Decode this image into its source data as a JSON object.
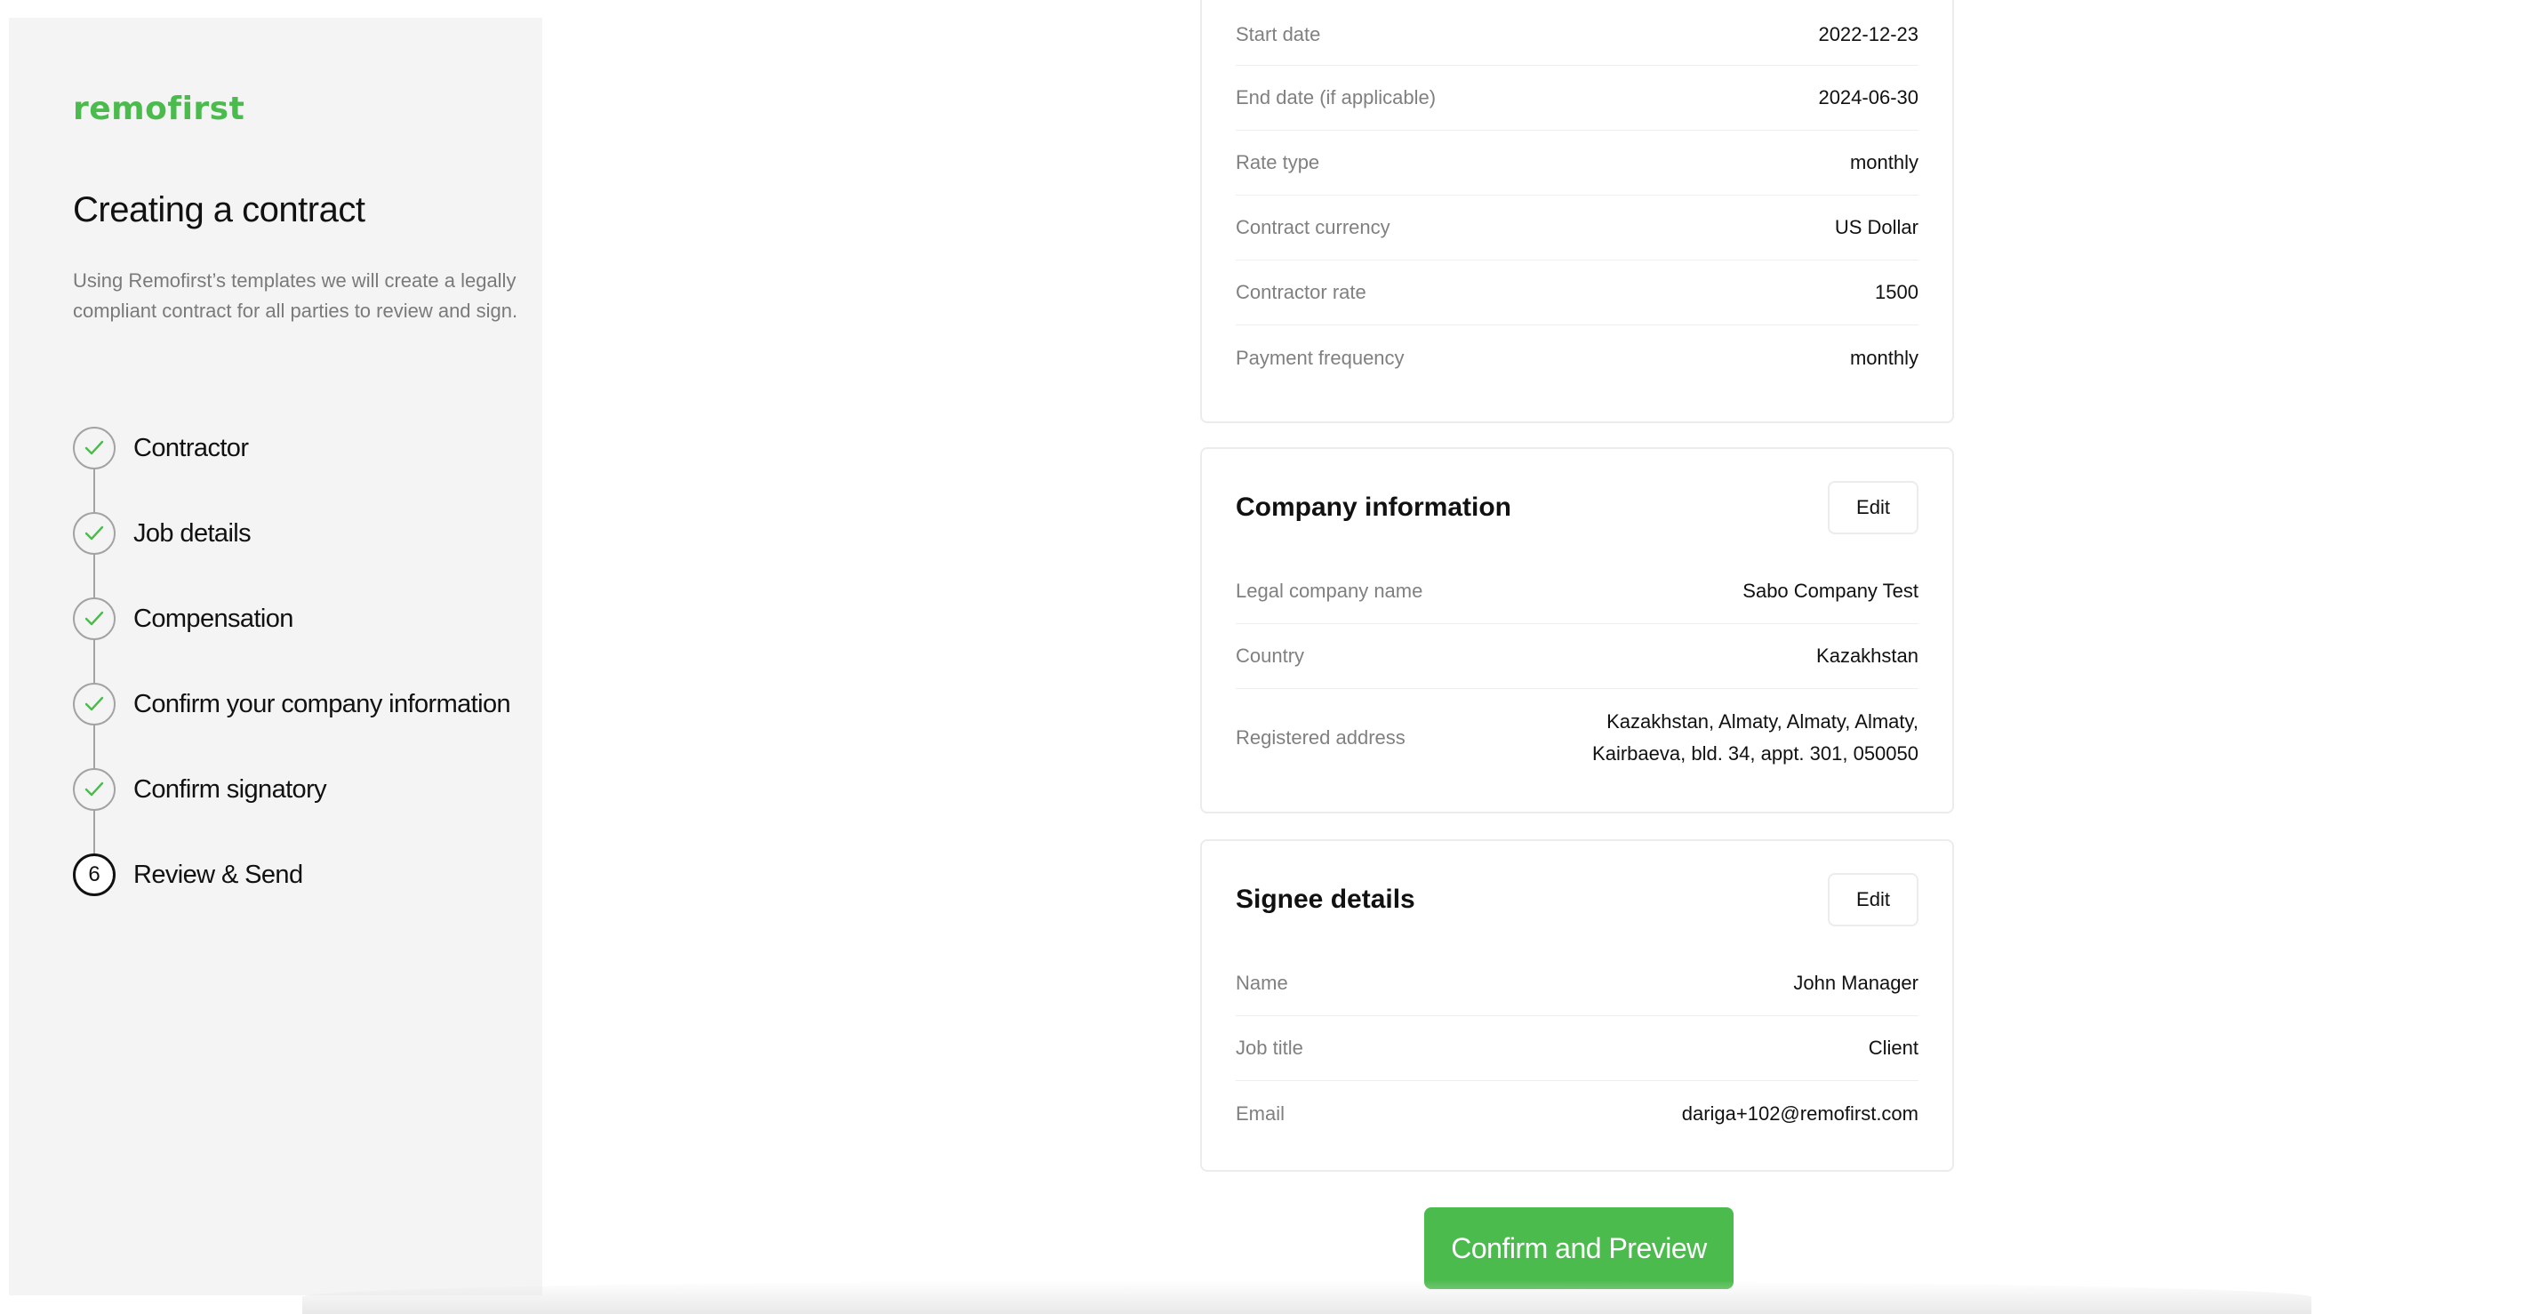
{
  "sidebar": {
    "logo": "remofirst",
    "title": "Creating a contract",
    "description": "Using Remofirst’s templates we will create a legally compliant contract for all parties to review and sign.",
    "steps": [
      {
        "label": "Contractor",
        "status": "done"
      },
      {
        "label": "Job details",
        "status": "done"
      },
      {
        "label": "Compensation",
        "status": "done"
      },
      {
        "label": "Confirm your company information",
        "status": "done"
      },
      {
        "label": "Confirm signatory",
        "status": "done"
      },
      {
        "label": "Review & Send",
        "status": "current",
        "number": "6"
      }
    ]
  },
  "compensation": {
    "rows": [
      {
        "label": "Start date",
        "value": "2022-12-23"
      },
      {
        "label": "End date (if applicable)",
        "value": "2024-06-30"
      },
      {
        "label": "Rate type",
        "value": "monthly"
      },
      {
        "label": "Contract currency",
        "value": "US Dollar"
      },
      {
        "label": "Contractor rate",
        "value": "1500"
      },
      {
        "label": "Payment frequency",
        "value": "monthly"
      }
    ]
  },
  "company": {
    "title": "Company information",
    "edit_label": "Edit",
    "rows": [
      {
        "label": "Legal company name",
        "value": "Sabo Company Test"
      },
      {
        "label": "Country",
        "value": "Kazakhstan"
      },
      {
        "label": "Registered address",
        "value_line1": "Kazakhstan, Almaty, Almaty, Almaty,",
        "value_line2": "Kairbaeva, bld. 34, appt. 301, 050050"
      }
    ]
  },
  "signee": {
    "title": "Signee details",
    "edit_label": "Edit",
    "rows": [
      {
        "label": "Name",
        "value": "John Manager"
      },
      {
        "label": "Job title",
        "value": "Client"
      },
      {
        "label": "Email",
        "value": "dariga+102@remofirst.com"
      }
    ]
  },
  "confirm_label": "Confirm and Preview",
  "colors": {
    "accent": "#4cbb4e",
    "step_border": "#a3a3a3",
    "muted_text": "#808080"
  }
}
